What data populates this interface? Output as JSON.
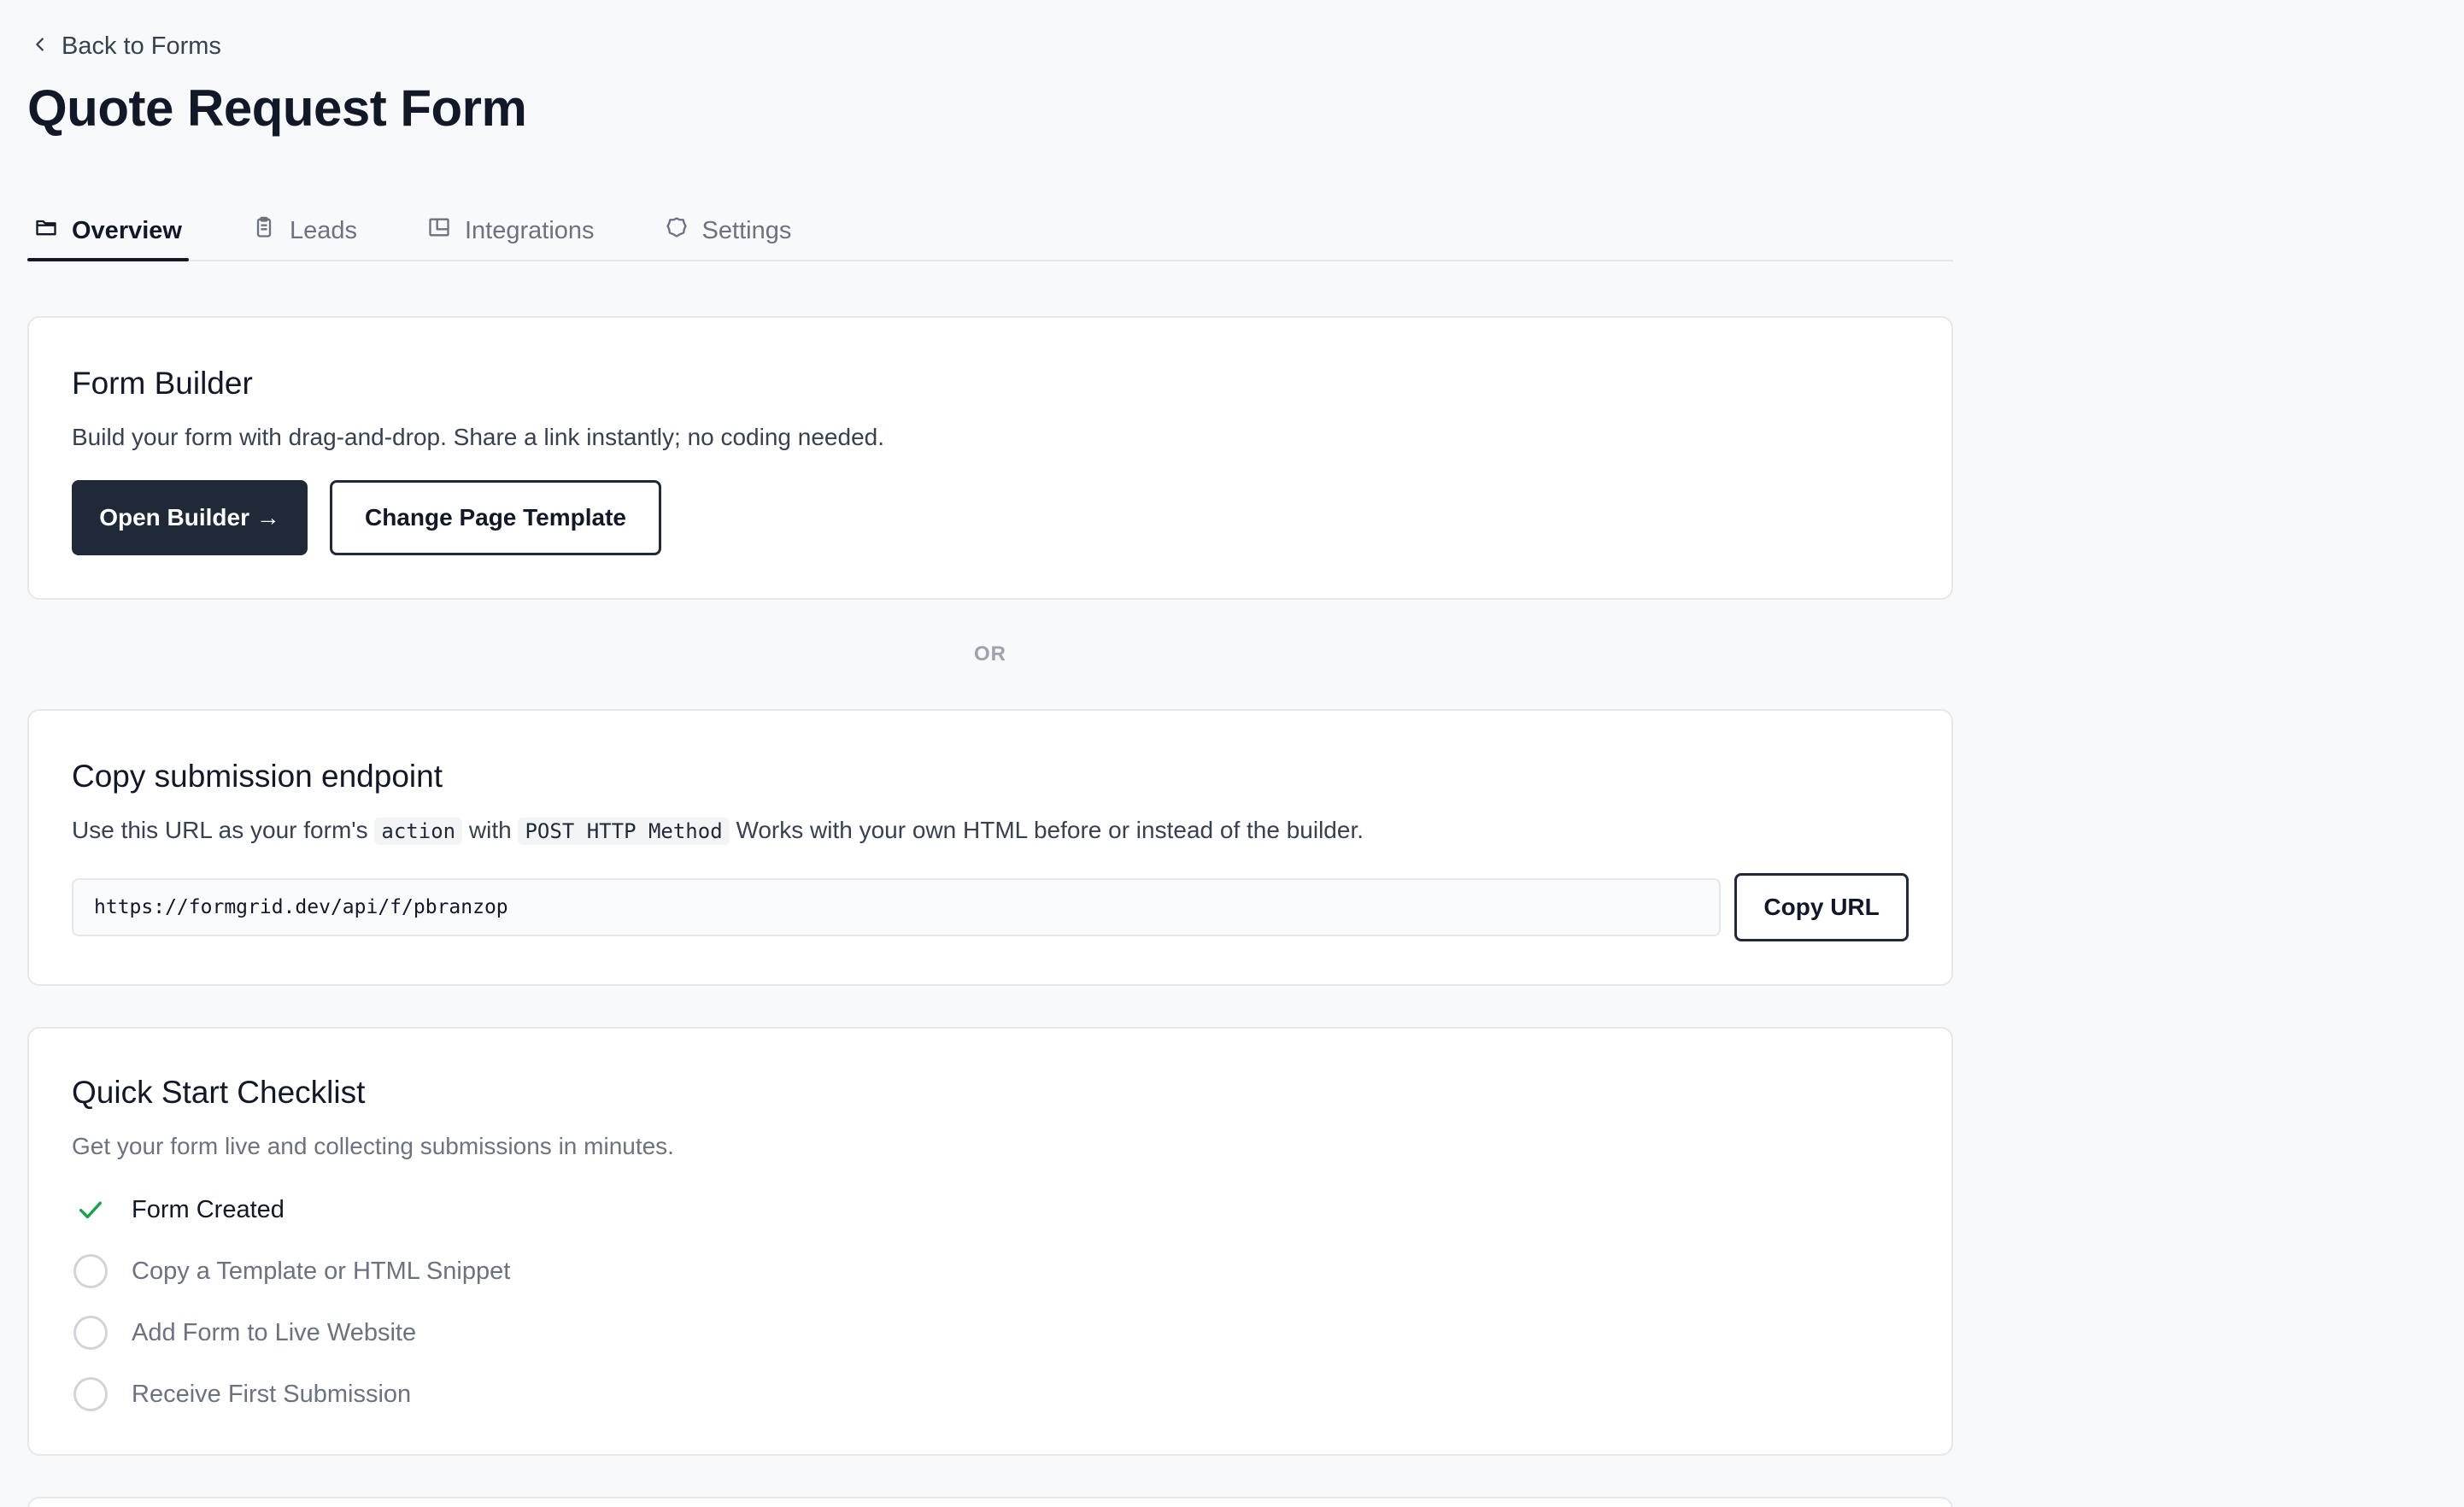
{
  "nav": {
    "back_label": "Back to Forms"
  },
  "page": {
    "title": "Quote Request Form"
  },
  "tabs": [
    {
      "label": "Overview",
      "icon": "folder-icon",
      "active": true
    },
    {
      "label": "Leads",
      "icon": "clipboard-icon",
      "active": false
    },
    {
      "label": "Integrations",
      "icon": "integrations-icon",
      "active": false
    },
    {
      "label": "Settings",
      "icon": "gear-icon",
      "active": false
    }
  ],
  "form_builder": {
    "title": "Form Builder",
    "description": "Build your form with drag-and-drop. Share a link instantly; no coding needed.",
    "open_builder_label": "Open Builder →",
    "change_template_label": "Change Page Template"
  },
  "separator": {
    "label": "OR"
  },
  "endpoint": {
    "title": "Copy submission endpoint",
    "desc_part1": "Use this URL as your form's",
    "code_action": "action",
    "desc_part2": "with",
    "code_method": "POST HTTP Method",
    "desc_part3": "Works with your own HTML before or instead of the builder.",
    "url": "https://formgrid.dev/api/f/pbranzop",
    "copy_label": "Copy URL"
  },
  "checklist": {
    "title": "Quick Start Checklist",
    "description": "Get your form live and collecting submissions in minutes.",
    "items": [
      {
        "label": "Form Created",
        "done": true
      },
      {
        "label": "Copy a Template or HTML Snippet",
        "done": false
      },
      {
        "label": "Add Form to Live Website",
        "done": false
      },
      {
        "label": "Receive First Submission",
        "done": false
      }
    ]
  },
  "colors": {
    "primary_dark": "#1f2937",
    "success_green": "#16a34a",
    "page_bg": "#f8f9fb",
    "border": "#e5e7eb"
  }
}
